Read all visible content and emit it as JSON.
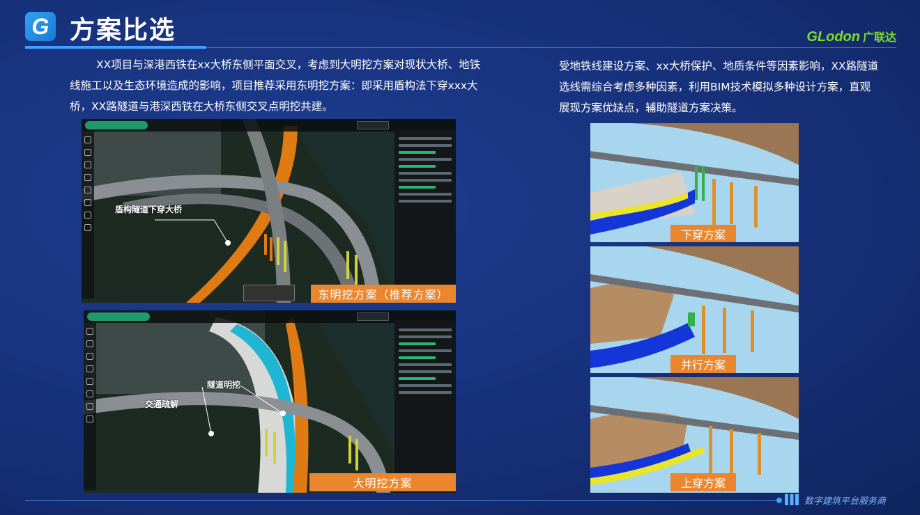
{
  "header": {
    "logo_letter": "G",
    "title": "方案比选",
    "brand": "GLodon",
    "brand_cn": "广联达"
  },
  "left_text": "XX项目与深港西铁在xx大桥东侧平面交叉，考虑到大明挖方案对现状大桥、地铁线施工以及生态环境造成的影响，项目推荐采用东明挖方案：即采用盾构法下穿xxx大桥，XX路隧道与港深西铁在大桥东侧交叉点明挖共建。",
  "right_text": "受地铁线建设方案、xx大桥保护、地质条件等因素影响，XX路隧道选线需综合考虑多种因素，利用BIM技术模拟多种设计方案，直观展现方案优缺点，辅助隧道方案决策。",
  "screens": [
    {
      "caption": "东明挖方案（推荐方案）",
      "annotations": [
        "盾构隧道下穿大桥"
      ]
    },
    {
      "caption": "大明挖方案",
      "annotations": [
        "隧道明挖",
        "交通疏解"
      ]
    }
  ],
  "renders": [
    {
      "caption": "下穿方案"
    },
    {
      "caption": "并行方案"
    },
    {
      "caption": "上穿方案"
    }
  ],
  "footer": {
    "slogan": "数字建筑平台服务商"
  },
  "colors": {
    "accent_orange": "#e9862e",
    "brand_green": "#7ddc2b",
    "bg": "#16307a"
  }
}
